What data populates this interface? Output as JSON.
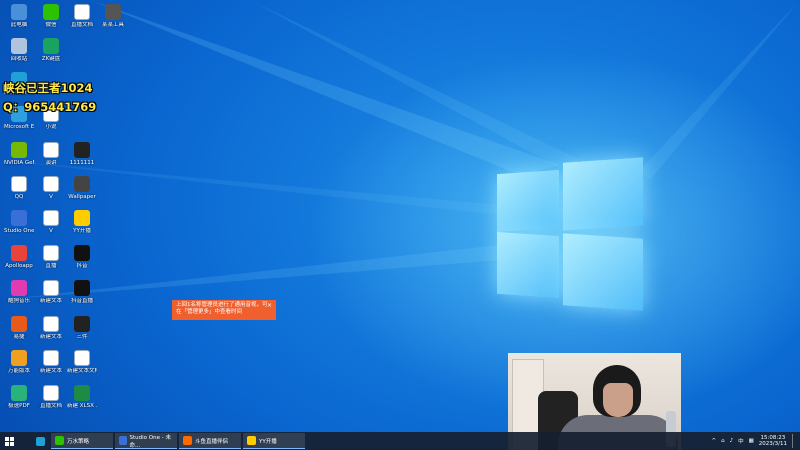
{
  "overlay": {
    "line1": "峡谷已王者1024",
    "line2": "Q：965441769"
  },
  "desktop_icons": [
    {
      "label": "此电脑",
      "icon": "computer-icon",
      "color": "#4a90d9"
    },
    {
      "label": "回收站",
      "icon": "recycle-bin-icon",
      "color": "#b0c4de"
    },
    {
      "label": "Microsoft Edge",
      "icon": "edge-icon",
      "color": "#1fa0d8"
    },
    {
      "label": "Microsoft Edge",
      "icon": "edge-icon",
      "color": "#2ea0e0"
    },
    {
      "label": "NVIDIA GeForce",
      "icon": "nvidia-icon",
      "color": "#76b900"
    },
    {
      "label": "QQ",
      "icon": "qq-icon",
      "color": "#ffffff"
    },
    {
      "label": "Studio One",
      "icon": "studio-one-icon",
      "color": "#3a6fd8"
    },
    {
      "label": "Apolloapp",
      "icon": "app-icon",
      "color": "#e8443a"
    },
    {
      "label": "酷狗音乐",
      "icon": "music-icon",
      "color": "#e03bb0"
    },
    {
      "label": "易捷",
      "icon": "app-icon",
      "color": "#e85a1a"
    },
    {
      "label": "万能版本",
      "icon": "app-icon",
      "color": "#f0a020"
    },
    {
      "label": "极速PDF",
      "icon": "pdf-icon",
      "color": "#2ab27b"
    },
    {
      "label": "微信",
      "icon": "wechat-icon",
      "color": "#2dc100"
    },
    {
      "label": "ZK键盘",
      "icon": "keyboard-icon",
      "color": "#1aa260"
    },
    {
      "label": "小说",
      "icon": "file-icon",
      "color": "#ffffff"
    },
    {
      "label": "演讲",
      "icon": "file-icon",
      "color": "#ffffff"
    },
    {
      "label": "V",
      "icon": "file-icon",
      "color": "#ffffff"
    },
    {
      "label": "V",
      "icon": "file-icon",
      "color": "#ffffff"
    },
    {
      "label": "直播",
      "icon": "file-icon",
      "color": "#ffffff"
    },
    {
      "label": "新建文本",
      "icon": "file-icon",
      "color": "#ffffff"
    },
    {
      "label": "新建文本",
      "icon": "file-icon",
      "color": "#ffffff"
    },
    {
      "label": "新建文本",
      "icon": "file-icon",
      "color": "#ffffff"
    },
    {
      "label": "直播文档",
      "icon": "file-icon",
      "color": "#ffffff"
    },
    {
      "label": "直播文档",
      "icon": "file-icon",
      "color": "#ffffff"
    },
    {
      "label": "1111111",
      "icon": "terminal-icon",
      "color": "#222222"
    },
    {
      "label": "Wallpaper",
      "icon": "app-icon",
      "color": "#444444"
    },
    {
      "label": "YY开播",
      "icon": "yy-icon",
      "color": "#ffcc00"
    },
    {
      "label": "抖音",
      "icon": "douyin-icon",
      "color": "#111111"
    },
    {
      "label": "抖音直播",
      "icon": "douyin-icon",
      "color": "#111111"
    },
    {
      "label": "三件",
      "icon": "terminal-icon",
      "color": "#222222"
    },
    {
      "label": "新建文本文档",
      "icon": "file-icon",
      "color": "#ffffff"
    },
    {
      "label": "新建 XLSX 工作表",
      "icon": "excel-icon",
      "color": "#1d8a45"
    },
    {
      "label": "某某工具",
      "icon": "app-icon",
      "color": "#555555"
    }
  ],
  "toast": {
    "text": "上回1名称管理员进行了通用音视，可在「管理更多」中查看时间",
    "close": "×"
  },
  "taskbar": {
    "items": [
      {
        "label": "",
        "icon": "edge-icon",
        "color": "#1fa0d8"
      },
      {
        "label": "万水策略",
        "icon": "app-icon",
        "color": "#2dc100"
      },
      {
        "label": "Studio One - 未命...",
        "icon": "studio-one-icon",
        "color": "#3a6fd8"
      },
      {
        "label": "斗鱼直播伴侣",
        "icon": "app-icon",
        "color": "#ff6a00"
      },
      {
        "label": "YY开播",
        "icon": "yy-icon",
        "color": "#ffcc00"
      }
    ],
    "tray": {
      "ime": "中",
      "time": "15:08:23",
      "date": "2023/3/11"
    }
  }
}
